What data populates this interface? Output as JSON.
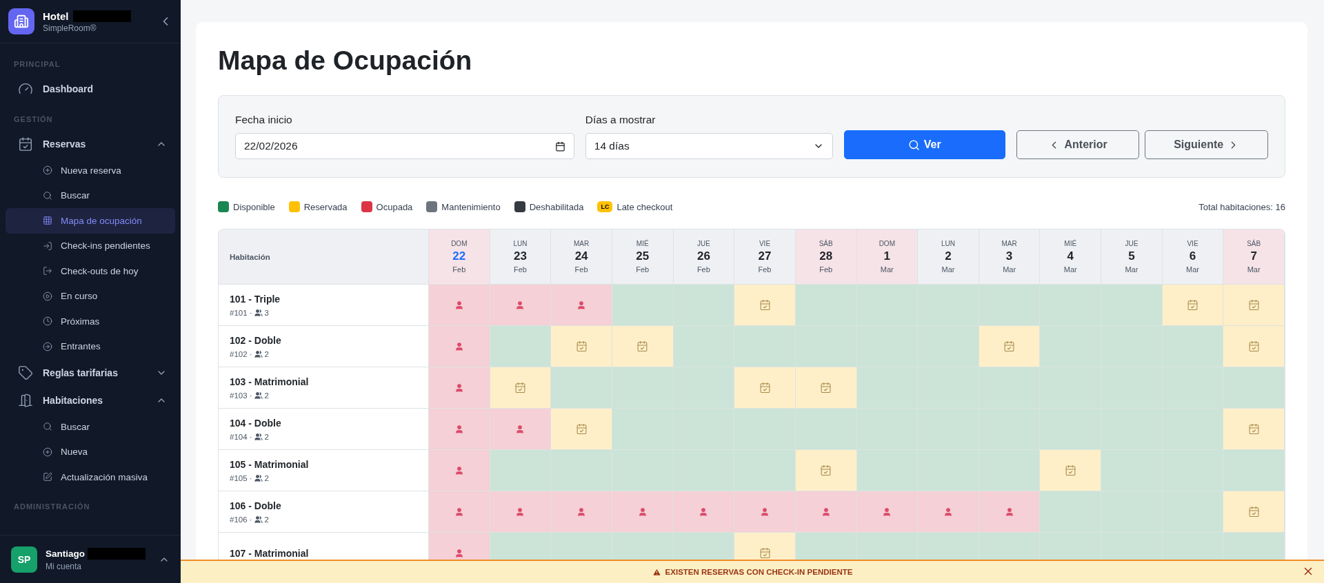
{
  "sidebar": {
    "brand": {
      "title": "Hotel",
      "subtitle": "SimpleRoom®",
      "redacted": true
    },
    "sections": [
      {
        "label": "PRINCIPAL",
        "items": [
          {
            "label": "Dashboard",
            "selected": false
          }
        ]
      },
      {
        "label": "GESTIÓN",
        "items": [
          {
            "label": "Reservas",
            "selected": false,
            "expanded": true,
            "children": [
              {
                "label": "Nueva reserva",
                "selected": false
              },
              {
                "label": "Buscar",
                "selected": false
              },
              {
                "label": "Mapa de ocupación",
                "selected": true
              },
              {
                "label": "Check-ins pendientes",
                "selected": false
              },
              {
                "label": "Check-outs de hoy",
                "selected": false
              },
              {
                "label": "En curso",
                "selected": false
              },
              {
                "label": "Próximas",
                "selected": false
              },
              {
                "label": "Entrantes",
                "selected": false
              }
            ]
          },
          {
            "label": "Reglas tarifarias",
            "selected": false,
            "expanded": false
          },
          {
            "label": "Habitaciones",
            "selected": false,
            "expanded": true,
            "children": [
              {
                "label": "Buscar",
                "selected": false
              },
              {
                "label": "Nueva",
                "selected": false
              },
              {
                "label": "Actualización masiva",
                "selected": false
              }
            ]
          }
        ]
      },
      {
        "label": "ADMINISTRACIÓN"
      }
    ],
    "user": {
      "initials": "SP",
      "name": "Santiago",
      "subtitle": "Mi cuenta",
      "redacted": true
    }
  },
  "page": {
    "title": "Mapa de Ocupación"
  },
  "filters": {
    "start_date": {
      "label": "Fecha inicio",
      "value": "22/02/2026"
    },
    "days": {
      "label": "Días a mostrar",
      "value": "14 días"
    },
    "buttons": [
      {
        "kind": "primary",
        "label": "Ver"
      },
      {
        "kind": "prev",
        "label": "Anterior"
      },
      {
        "kind": "next",
        "label": "Siguiente"
      }
    ]
  },
  "legend": [
    {
      "kind": "swatch",
      "label": "Disponible",
      "color": "#198754"
    },
    {
      "kind": "swatch",
      "label": "Reservada",
      "color": "#ffc107"
    },
    {
      "kind": "swatch",
      "label": "Ocupada",
      "color": "#dc3545"
    },
    {
      "kind": "swatch",
      "label": "Mantenimiento",
      "color": "#6c757d"
    },
    {
      "kind": "swatch",
      "label": "Deshabilitada",
      "color": "#343a40"
    },
    {
      "kind": "badge",
      "badge": "LC",
      "label": "Late checkout",
      "color": "#ffc107"
    }
  ],
  "total": "Total habitaciones: 16",
  "table": {
    "room_header": "Habitación",
    "days": [
      {
        "weekday": "DOM",
        "day": "22",
        "month": "Feb",
        "weekend": true,
        "today": true
      },
      {
        "weekday": "LUN",
        "day": "23",
        "month": "Feb",
        "weekend": false,
        "today": false
      },
      {
        "weekday": "MAR",
        "day": "24",
        "month": "Feb",
        "weekend": false,
        "today": false
      },
      {
        "weekday": "MIÉ",
        "day": "25",
        "month": "Feb",
        "weekend": false,
        "today": false
      },
      {
        "weekday": "JUE",
        "day": "26",
        "month": "Feb",
        "weekend": false,
        "today": false
      },
      {
        "weekday": "VIE",
        "day": "27",
        "month": "Feb",
        "weekend": false,
        "today": false
      },
      {
        "weekday": "SÁB",
        "day": "28",
        "month": "Feb",
        "weekend": true,
        "today": false
      },
      {
        "weekday": "DOM",
        "day": "1",
        "month": "Mar",
        "weekend": true,
        "today": false
      },
      {
        "weekday": "LUN",
        "day": "2",
        "month": "Mar",
        "weekend": false,
        "today": false
      },
      {
        "weekday": "MAR",
        "day": "3",
        "month": "Mar",
        "weekend": false,
        "today": false
      },
      {
        "weekday": "MIÉ",
        "day": "4",
        "month": "Mar",
        "weekend": false,
        "today": false
      },
      {
        "weekday": "JUE",
        "day": "5",
        "month": "Mar",
        "weekend": false,
        "today": false
      },
      {
        "weekday": "VIE",
        "day": "6",
        "month": "Mar",
        "weekend": false,
        "today": false
      },
      {
        "weekday": "SÁB",
        "day": "7",
        "month": "Mar",
        "weekend": true,
        "today": false
      }
    ],
    "rooms": [
      {
        "name": "101 - Triple",
        "number": "#101 ·",
        "capacity": "3",
        "cells": [
          {
            "kind": "occupied"
          },
          {
            "kind": "occupied"
          },
          {
            "kind": "occupied"
          },
          {
            "kind": "available"
          },
          {
            "kind": "available"
          },
          {
            "kind": "reserved"
          },
          {
            "kind": "available"
          },
          {
            "kind": "available"
          },
          {
            "kind": "available"
          },
          {
            "kind": "available"
          },
          {
            "kind": "available"
          },
          {
            "kind": "available"
          },
          {
            "kind": "reserved"
          },
          {
            "kind": "reserved"
          }
        ]
      },
      {
        "name": "102 - Doble",
        "number": "#102 ·",
        "capacity": "2",
        "cells": [
          {
            "kind": "occupied"
          },
          {
            "kind": "available"
          },
          {
            "kind": "reserved"
          },
          {
            "kind": "reserved"
          },
          {
            "kind": "available"
          },
          {
            "kind": "available"
          },
          {
            "kind": "available"
          },
          {
            "kind": "available"
          },
          {
            "kind": "available"
          },
          {
            "kind": "reserved"
          },
          {
            "kind": "available"
          },
          {
            "kind": "available"
          },
          {
            "kind": "available"
          },
          {
            "kind": "reserved"
          }
        ]
      },
      {
        "name": "103 - Matrimonial",
        "number": "#103 ·",
        "capacity": "2",
        "cells": [
          {
            "kind": "occupied"
          },
          {
            "kind": "reserved"
          },
          {
            "kind": "available"
          },
          {
            "kind": "available"
          },
          {
            "kind": "available"
          },
          {
            "kind": "reserved"
          },
          {
            "kind": "reserved"
          },
          {
            "kind": "available"
          },
          {
            "kind": "available"
          },
          {
            "kind": "available"
          },
          {
            "kind": "available"
          },
          {
            "kind": "available"
          },
          {
            "kind": "available"
          },
          {
            "kind": "available"
          }
        ]
      },
      {
        "name": "104 - Doble",
        "number": "#104 ·",
        "capacity": "2",
        "cells": [
          {
            "kind": "occupied"
          },
          {
            "kind": "occupied"
          },
          {
            "kind": "reserved"
          },
          {
            "kind": "available"
          },
          {
            "kind": "available"
          },
          {
            "kind": "available"
          },
          {
            "kind": "available"
          },
          {
            "kind": "available"
          },
          {
            "kind": "available"
          },
          {
            "kind": "available"
          },
          {
            "kind": "available"
          },
          {
            "kind": "available"
          },
          {
            "kind": "available"
          },
          {
            "kind": "reserved"
          }
        ]
      },
      {
        "name": "105 - Matrimonial",
        "number": "#105 ·",
        "capacity": "2",
        "cells": [
          {
            "kind": "occupied"
          },
          {
            "kind": "available"
          },
          {
            "kind": "available"
          },
          {
            "kind": "available"
          },
          {
            "kind": "available"
          },
          {
            "kind": "available"
          },
          {
            "kind": "reserved"
          },
          {
            "kind": "available"
          },
          {
            "kind": "available"
          },
          {
            "kind": "available"
          },
          {
            "kind": "reserved"
          },
          {
            "kind": "available"
          },
          {
            "kind": "available"
          },
          {
            "kind": "available"
          }
        ]
      },
      {
        "name": "106 - Doble",
        "number": "#106 ·",
        "capacity": "2",
        "cells": [
          {
            "kind": "occupied"
          },
          {
            "kind": "occupied"
          },
          {
            "kind": "occupied"
          },
          {
            "kind": "occupied"
          },
          {
            "kind": "occupied"
          },
          {
            "kind": "occupied"
          },
          {
            "kind": "occupied"
          },
          {
            "kind": "occupied"
          },
          {
            "kind": "occupied"
          },
          {
            "kind": "occupied"
          },
          {
            "kind": "available"
          },
          {
            "kind": "available"
          },
          {
            "kind": "available"
          },
          {
            "kind": "reserved"
          }
        ]
      },
      {
        "name": "107 - Matrimonial",
        "cells": [
          {
            "kind": "occupied"
          },
          {
            "kind": "available"
          },
          {
            "kind": "available"
          },
          {
            "kind": "available"
          },
          {
            "kind": "available"
          },
          {
            "kind": "reserved"
          },
          {
            "kind": "available"
          },
          {
            "kind": "available"
          },
          {
            "kind": "available"
          },
          {
            "kind": "available"
          },
          {
            "kind": "available"
          },
          {
            "kind": "available"
          },
          {
            "kind": "available"
          },
          {
            "kind": "available"
          }
        ]
      }
    ]
  },
  "banner": {
    "text": "EXISTEN RESERVAS CON CHECK-IN PENDIENTE"
  }
}
